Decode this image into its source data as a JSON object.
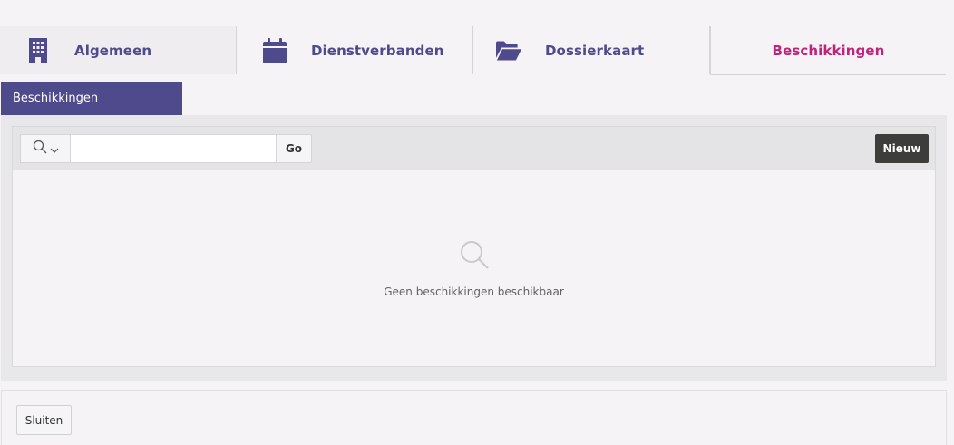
{
  "tabs": [
    {
      "label": "Algemeen",
      "icon": "building-icon"
    },
    {
      "label": "Dienstverbanden",
      "icon": "calendar-icon"
    },
    {
      "label": "Dossierkaart",
      "icon": "folder-open-icon"
    },
    {
      "label": "Beschikkingen",
      "icon": "",
      "active": true
    }
  ],
  "section": {
    "title": "Beschikkingen"
  },
  "toolbar": {
    "search_icon": "search-icon",
    "search_value": "",
    "go_label": "Go",
    "new_label": "Nieuw"
  },
  "empty": {
    "icon": "search-icon",
    "message": "Geen beschikkingen beschikbaar"
  },
  "footer": {
    "close_label": "Sluiten"
  },
  "colors": {
    "accent": "#4e4a8b",
    "active_tab": "#c0237a",
    "primary_button": "#3d3d3b",
    "background": "#f5f3f6"
  }
}
